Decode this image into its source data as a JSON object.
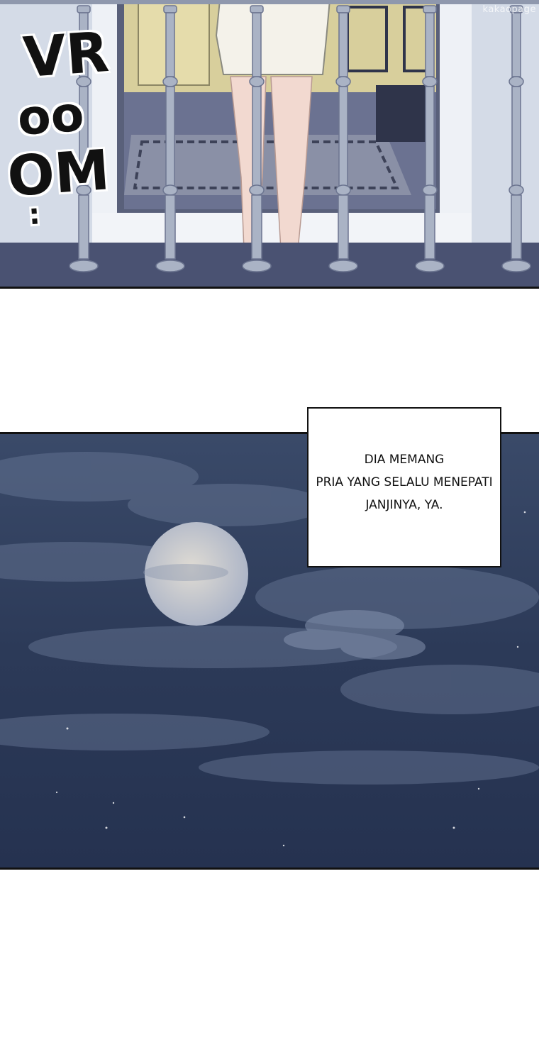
{
  "sfx": {
    "line1": "VR",
    "line2": "oo",
    "line3": "OM",
    "line4": ":"
  },
  "watermark": "kakaopage",
  "caption": {
    "lines": [
      "DIA MEMANG",
      "PRIA YANG SELALU MENEPATI",
      "JANJINYA, YA."
    ]
  },
  "colors": {
    "sky": "#2f3e5c",
    "moon": "#cfd3dc",
    "railing": "#aab3c5",
    "floor": "#4a5272"
  }
}
